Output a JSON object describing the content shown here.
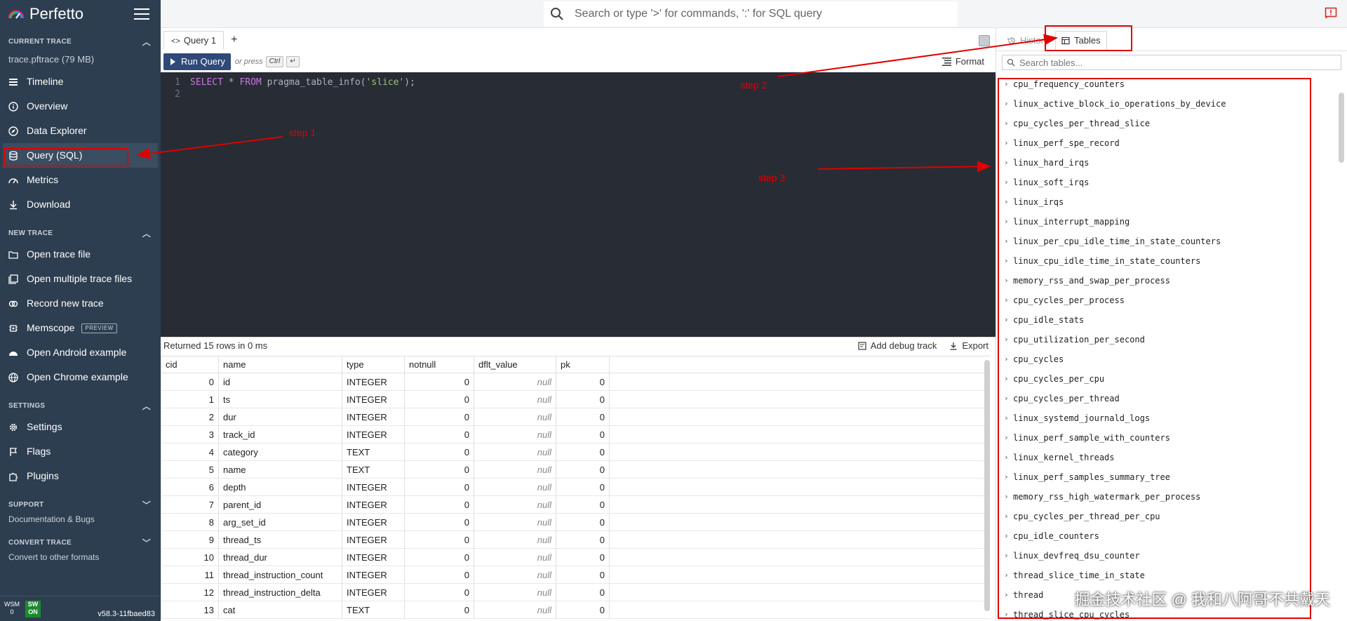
{
  "sidebar": {
    "brand": "Perfetto",
    "current_trace": {
      "header": "CURRENT TRACE",
      "file": "trace.pftrace (79 MB)",
      "items": [
        {
          "label": "Timeline",
          "icon": "timeline-icon"
        },
        {
          "label": "Overview",
          "icon": "info-icon"
        },
        {
          "label": "Data Explorer",
          "icon": "explore-icon"
        },
        {
          "label": "Query (SQL)",
          "icon": "database-icon"
        },
        {
          "label": "Metrics",
          "icon": "speed-icon"
        },
        {
          "label": "Download",
          "icon": "download-icon"
        }
      ]
    },
    "new_trace": {
      "header": "NEW TRACE",
      "items": [
        {
          "label": "Open trace file",
          "icon": "folder-icon"
        },
        {
          "label": "Open multiple trace files",
          "icon": "library-icon"
        },
        {
          "label": "Record new trace",
          "icon": "record-icon"
        },
        {
          "label": "Memscope",
          "icon": "memory-icon",
          "badge": "PREVIEW"
        },
        {
          "label": "Open Android example",
          "icon": "android-icon"
        },
        {
          "label": "Open Chrome example",
          "icon": "language-icon"
        }
      ]
    },
    "settings": {
      "header": "SETTINGS",
      "items": [
        {
          "label": "Settings",
          "icon": "gear-icon"
        },
        {
          "label": "Flags",
          "icon": "flag-icon"
        },
        {
          "label": "Plugins",
          "icon": "extension-icon"
        }
      ]
    },
    "support": {
      "header": "SUPPORT",
      "sub": "Documentation & Bugs"
    },
    "convert": {
      "header": "CONVERT TRACE",
      "sub": "Convert to other formats"
    },
    "footer": {
      "wsm_top": "WSM",
      "wsm_bottom": "0",
      "sw_top": "SW",
      "sw_bottom": "ON",
      "version": "v58.3-11fbaed83"
    }
  },
  "omnibox": {
    "placeholder": "Search or type '>' for commands, ':' for SQL query"
  },
  "editor": {
    "tab_label": "Query 1",
    "add_tab": "+",
    "run_label": "Run Query",
    "or_press": "or press",
    "kbd1": "Ctrl",
    "kbd2": "↵",
    "format_label": "Format",
    "line1_no": "1",
    "line2_no": "2",
    "code": {
      "kw1": "SELECT",
      "mid1": " * ",
      "kw2": "FROM",
      "mid2": " pragma_table_info(",
      "str": "'slice'",
      "end": ");"
    }
  },
  "results": {
    "summary": "Returned 15 rows in 0 ms",
    "add_debug_track": "Add debug track",
    "export": "Export",
    "columns": [
      "cid",
      "name",
      "type",
      "notnull",
      "dflt_value",
      "pk"
    ],
    "rows": [
      [
        "0",
        "id",
        "INTEGER",
        "0",
        "null",
        "0"
      ],
      [
        "1",
        "ts",
        "INTEGER",
        "0",
        "null",
        "0"
      ],
      [
        "2",
        "dur",
        "INTEGER",
        "0",
        "null",
        "0"
      ],
      [
        "3",
        "track_id",
        "INTEGER",
        "0",
        "null",
        "0"
      ],
      [
        "4",
        "category",
        "TEXT",
        "0",
        "null",
        "0"
      ],
      [
        "5",
        "name",
        "TEXT",
        "0",
        "null",
        "0"
      ],
      [
        "6",
        "depth",
        "INTEGER",
        "0",
        "null",
        "0"
      ],
      [
        "7",
        "parent_id",
        "INTEGER",
        "0",
        "null",
        "0"
      ],
      [
        "8",
        "arg_set_id",
        "INTEGER",
        "0",
        "null",
        "0"
      ],
      [
        "9",
        "thread_ts",
        "INTEGER",
        "0",
        "null",
        "0"
      ],
      [
        "10",
        "thread_dur",
        "INTEGER",
        "0",
        "null",
        "0"
      ],
      [
        "11",
        "thread_instruction_count",
        "INTEGER",
        "0",
        "null",
        "0"
      ],
      [
        "12",
        "thread_instruction_delta",
        "INTEGER",
        "0",
        "null",
        "0"
      ],
      [
        "13",
        "cat",
        "TEXT",
        "0",
        "null",
        "0"
      ]
    ]
  },
  "right_panel": {
    "history_tab": "History",
    "tables_tab": "Tables",
    "search_placeholder": "Search tables...",
    "tables": [
      "cpu_frequency_counters",
      "linux_active_block_io_operations_by_device",
      "cpu_cycles_per_thread_slice",
      "linux_perf_spe_record",
      "linux_hard_irqs",
      "linux_soft_irqs",
      "linux_irqs",
      "linux_interrupt_mapping",
      "linux_per_cpu_idle_time_in_state_counters",
      "linux_cpu_idle_time_in_state_counters",
      "memory_rss_and_swap_per_process",
      "cpu_cycles_per_process",
      "cpu_idle_stats",
      "cpu_utilization_per_second",
      "cpu_cycles",
      "cpu_cycles_per_cpu",
      "cpu_cycles_per_thread",
      "linux_systemd_journald_logs",
      "linux_perf_sample_with_counters",
      "linux_kernel_threads",
      "linux_perf_samples_summary_tree",
      "memory_rss_high_watermark_per_process",
      "cpu_cycles_per_thread_per_cpu",
      "cpu_idle_counters",
      "linux_devfreq_dsu_counter",
      "thread_slice_time_in_state",
      "thread",
      "thread_slice_cpu_cycles"
    ]
  },
  "annotations": {
    "step1": "step 1",
    "step2": "step 2",
    "step3": "step 3",
    "color": "#e00000"
  },
  "watermark": "掘金技术社区 @ 我和八阿哥不共戴天",
  "colors": {
    "sidebar_bg": "#2d3e50",
    "run_button": "#2f4a79",
    "editor_bg": "#282c34",
    "annotation": "#e00000"
  }
}
